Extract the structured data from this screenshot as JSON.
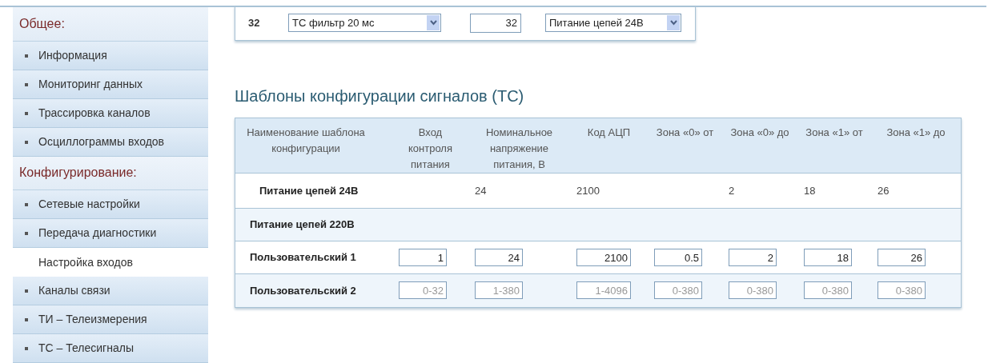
{
  "sidebar": {
    "sections": [
      {
        "title": "Общее:",
        "items": [
          {
            "label": "Информация",
            "selected": false
          },
          {
            "label": "Мониторинг данных",
            "selected": false
          },
          {
            "label": "Трассировка каналов",
            "selected": false
          },
          {
            "label": "Осциллограммы входов",
            "selected": false
          }
        ]
      },
      {
        "title": "Конфигурирование:",
        "items": [
          {
            "label": "Сетевые настройки",
            "selected": false
          },
          {
            "label": "Передача диагностики",
            "selected": false
          },
          {
            "label": "Настройка входов",
            "selected": true
          },
          {
            "label": "Каналы связи",
            "selected": false
          },
          {
            "label": "ТИ – Телеизмерения",
            "selected": false
          },
          {
            "label": "ТС – Телесигналы",
            "selected": false
          }
        ]
      }
    ]
  },
  "channel_row": {
    "number": "32",
    "filter": "ТС фильтр 20 мс",
    "value": "32",
    "template": "Питание цепей 24В"
  },
  "heading": "Шаблоны конфигурации сигналов (ТС)",
  "table": {
    "columns": [
      "Наименование шаблона конфигурации",
      "Вход контроля питания",
      "Номинальное напряжение питания, В",
      "Код АЦП",
      "Зона «0» от",
      "Зона «0» до",
      "Зона «1» от",
      "Зона «1» до"
    ],
    "rows": [
      {
        "name": "Питание цепей 24В",
        "kind": "text",
        "cells": [
          null,
          "24",
          "2100",
          null,
          "2",
          "18",
          "26"
        ]
      },
      {
        "name": "Питание цепей 220В",
        "kind": "text"
      },
      {
        "name": "Пользовательский 1",
        "kind": "input",
        "cells": [
          {
            "value": "1"
          },
          {
            "value": "24"
          },
          {
            "value": "2100"
          },
          {
            "value": "0.5"
          },
          {
            "value": "2"
          },
          {
            "value": "18"
          },
          {
            "value": "26"
          }
        ]
      },
      {
        "name": "Пользовательский 2",
        "kind": "input",
        "cells": [
          {
            "placeholder": "0-32"
          },
          {
            "placeholder": "1-380"
          },
          {
            "placeholder": "1-4096"
          },
          {
            "placeholder": "0-380"
          },
          {
            "placeholder": "0-380"
          },
          {
            "placeholder": "0-380"
          },
          {
            "placeholder": "0-380"
          }
        ]
      }
    ]
  }
}
